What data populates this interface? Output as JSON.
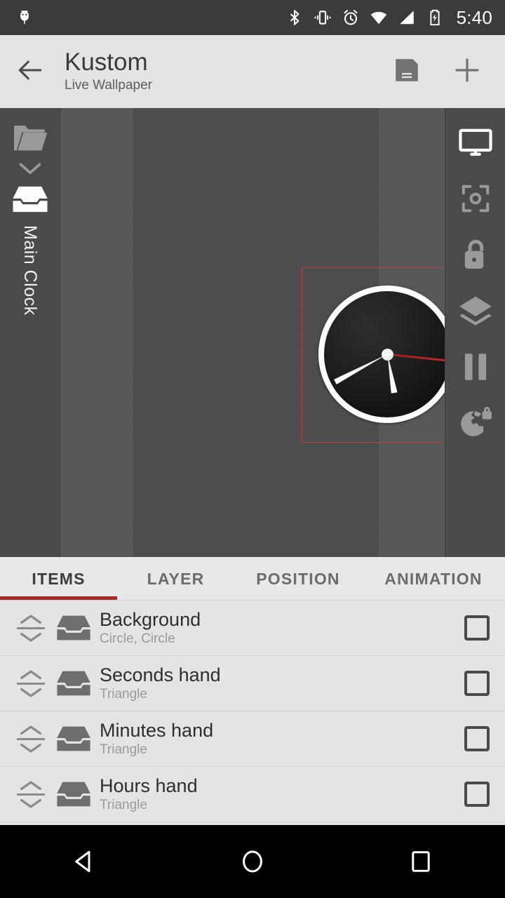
{
  "status_bar": {
    "time": "5:40",
    "icons": [
      "android-debug-icon",
      "bluetooth-icon",
      "vibrate-icon",
      "alarm-icon",
      "wifi-icon",
      "cell-signal-icon",
      "battery-charging-icon"
    ],
    "background": "#3b3b3b"
  },
  "app_bar": {
    "back_label": "back-arrow",
    "title": "Kustom",
    "subtitle": "Live Wallpaper",
    "save_label": "save",
    "add_label": "add",
    "background": "#e4e4e4"
  },
  "preview": {
    "left_sidebar": {
      "folder_icon": "folder-icon",
      "chevron_icon": "chevron-down-icon",
      "module_icon": "inbox-icon",
      "module_label": "Main Clock"
    },
    "right_sidebar": {
      "tools": [
        {
          "name": "screen-preview-icon",
          "label": "Screen",
          "active": true
        },
        {
          "name": "center-focus-icon",
          "label": "Center",
          "active": false
        },
        {
          "name": "unlock-icon",
          "label": "Unlock",
          "active": false
        },
        {
          "name": "layers-icon",
          "label": "Layers",
          "active": false
        },
        {
          "name": "pause-icon",
          "label": "Pause",
          "active": false
        },
        {
          "name": "globe-lock-icon",
          "label": "Global lock",
          "active": false
        }
      ]
    },
    "selection_color": "#b04545",
    "wallpaper_color": "#4d4d4d",
    "clock": {
      "hour_angle_deg": 170,
      "minute_angle_deg": 242,
      "second_angle_deg": 96,
      "second_hand_color": "#c02a2a",
      "face_color": "#141414",
      "ring_color": "#ffffff"
    }
  },
  "tabs": {
    "active_index": 0,
    "indicator_color": "#a32b2b",
    "items": [
      {
        "label": "ITEMS"
      },
      {
        "label": "LAYER"
      },
      {
        "label": "POSITION"
      },
      {
        "label": "ANIMATION"
      }
    ]
  },
  "items_list": {
    "rows": [
      {
        "title": "Background",
        "subtitle": "Circle, Circle",
        "icon": "inbox-icon",
        "checked": false
      },
      {
        "title": "Seconds hand",
        "subtitle": "Triangle",
        "icon": "inbox-icon",
        "checked": false
      },
      {
        "title": "Minutes hand",
        "subtitle": "Triangle",
        "icon": "inbox-icon",
        "checked": false
      },
      {
        "title": "Hours hand",
        "subtitle": "Triangle",
        "icon": "inbox-icon",
        "checked": false
      }
    ]
  },
  "nav_bar": {
    "back": "nav-back-icon",
    "home": "nav-home-icon",
    "recents": "nav-recents-icon"
  }
}
